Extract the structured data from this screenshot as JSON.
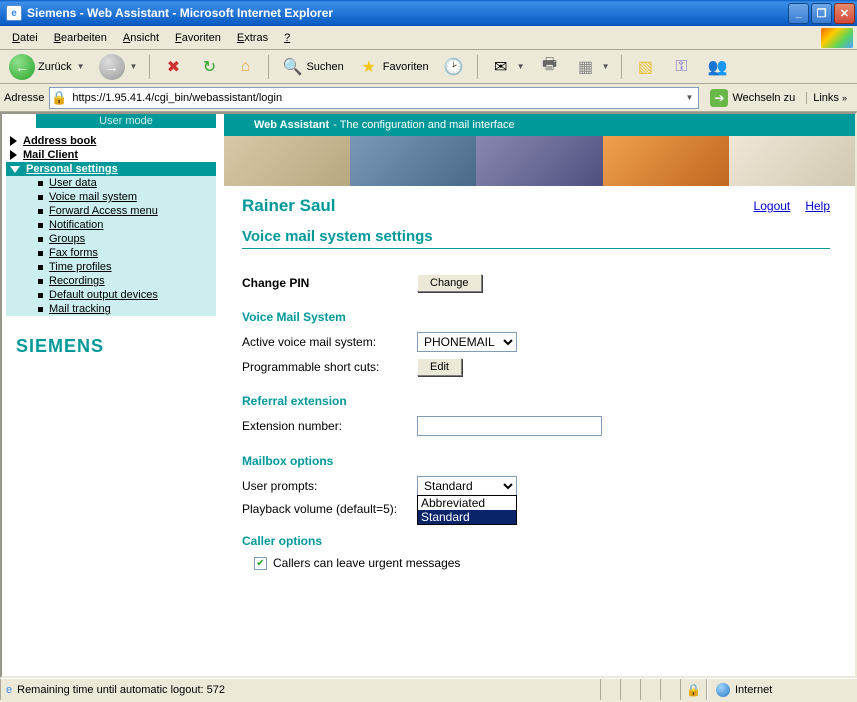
{
  "window": {
    "title": "Siemens - Web Assistant - Microsoft Internet Explorer"
  },
  "menu": {
    "items": [
      "Datei",
      "Bearbeiten",
      "Ansicht",
      "Favoriten",
      "Extras",
      "?"
    ]
  },
  "toolbar": {
    "back": "Zurück",
    "search": "Suchen",
    "favorites": "Favoriten"
  },
  "addressbar": {
    "label": "Adresse",
    "url": "https://1.95.41.4/cgi_bin/webassistant/login",
    "go": "Wechseln zu",
    "links": "Links"
  },
  "sidebar": {
    "mode": "User mode",
    "top1": "Address book",
    "top2": "Mail Client",
    "top3": "Personal settings",
    "subs": [
      "User data",
      "Voice mail system",
      "Forward Access menu",
      "Notification",
      "Groups",
      "Fax forms",
      "Time profiles",
      "Recordings",
      "Default output devices",
      "Mail tracking"
    ],
    "logo": "SIEMENS"
  },
  "banner": {
    "bold": "Web Assistant",
    "rest": " - The configuration and mail interface"
  },
  "main": {
    "user": "Rainer Saul",
    "logout": "Logout",
    "help": "Help",
    "title": "Voice mail system settings",
    "changepin_label": "Change PIN",
    "change_btn": "Change",
    "vms_section": "Voice Mail System",
    "active_label": "Active voice mail system:",
    "active_value": "PHONEMAIL",
    "shortcuts_label": "Programmable short cuts:",
    "edit_btn": "Edit",
    "ref_section": "Referral extension",
    "ext_label": "Extension number:",
    "ext_value": "",
    "mailbox_section": "Mailbox options",
    "prompts_label": "User prompts:",
    "prompts_sel": "Standard",
    "prompts_opts": [
      "Abbreviated",
      "Standard"
    ],
    "volume_label": "Playback volume (default=5):",
    "caller_section": "Caller options",
    "caller_check": "Callers can leave urgent messages"
  },
  "status": {
    "text": "Remaining time until automatic logout: 572",
    "zone": "Internet"
  }
}
